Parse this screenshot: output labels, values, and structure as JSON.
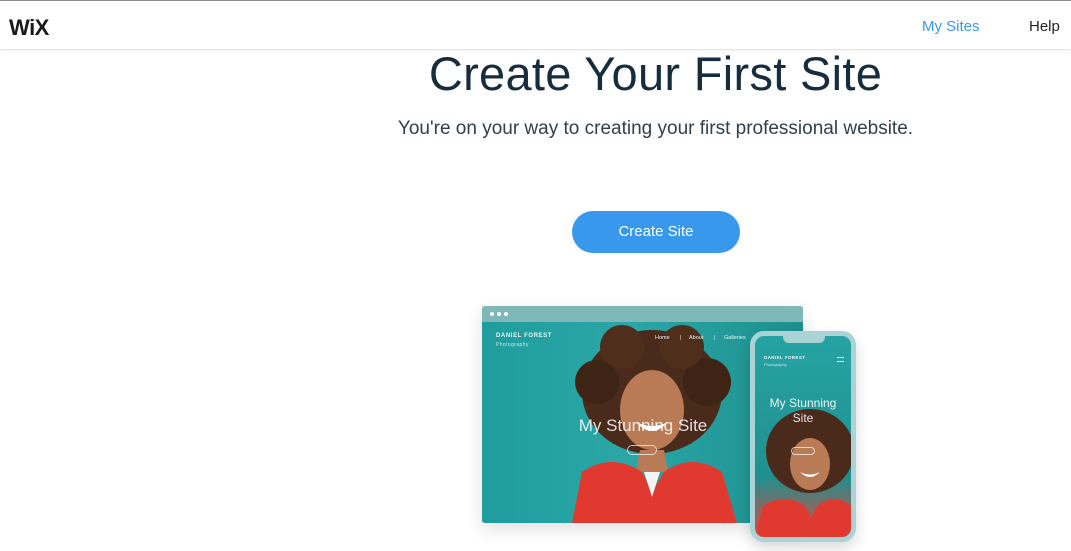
{
  "header": {
    "logo": "WiX",
    "nav": [
      "My Sites",
      "Help"
    ]
  },
  "main": {
    "title": "Create Your First Site",
    "subtitle": "You're on your way to creating your first professional website.",
    "cta_label": "Create Site"
  },
  "illustration": {
    "desktop": {
      "brand": "DANIEL FOREST",
      "brand_sub": "Photography",
      "nav": [
        "Home",
        "|",
        "About",
        "|",
        "Galleries"
      ],
      "hero_text": "My Stunning Site"
    },
    "phone": {
      "brand": "DANIEL FOREST",
      "brand_sub": "Photography",
      "hero_text": "My Stunning Site"
    }
  },
  "colors": {
    "accent": "#3899ec",
    "title": "#162d3d",
    "teal": "#22a3a3"
  }
}
